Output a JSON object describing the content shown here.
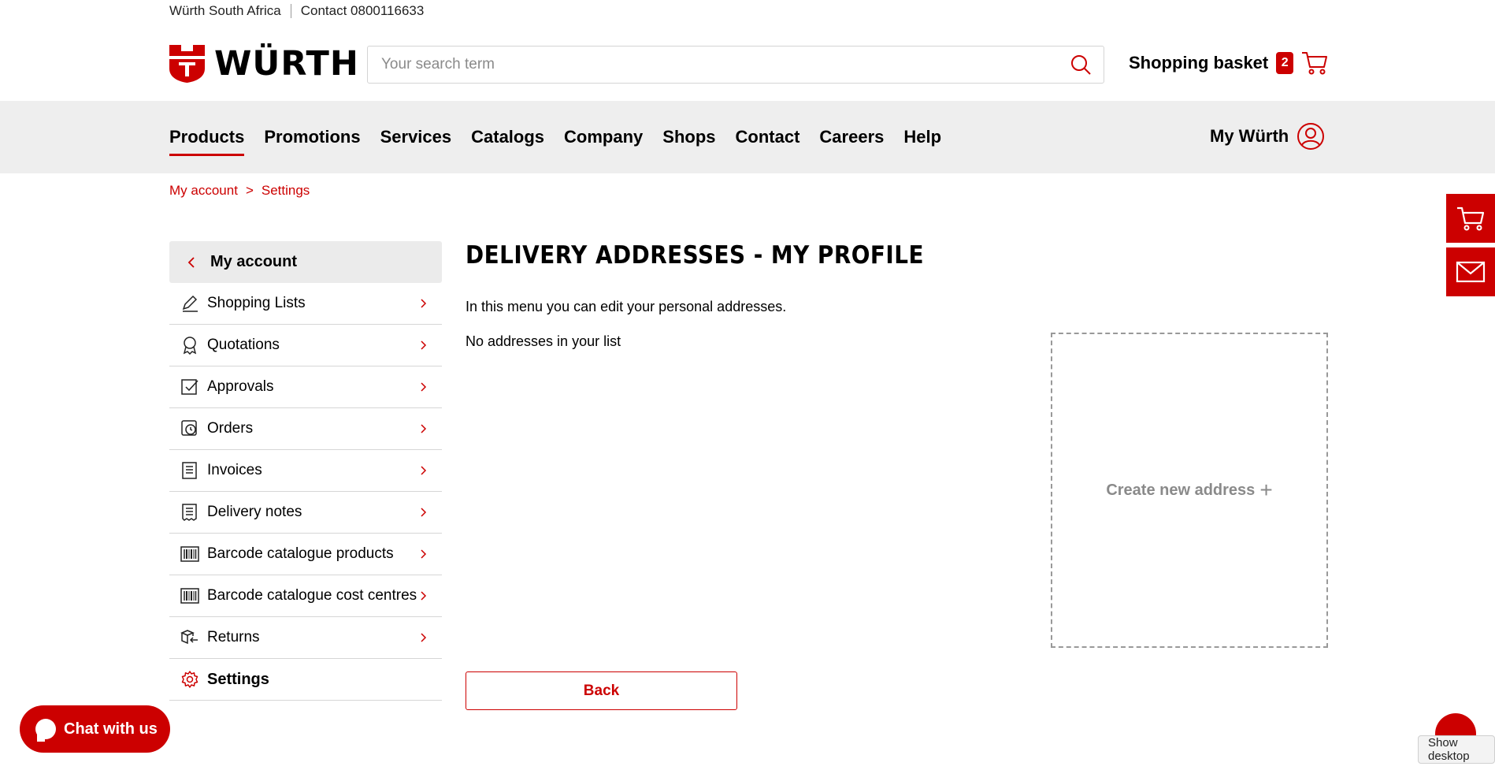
{
  "topbar": {
    "country": "Würth South Africa",
    "contact": "Contact 0800116633"
  },
  "header": {
    "brand": "WÜRTH",
    "search_placeholder": "Your search term",
    "basket_label": "Shopping basket",
    "basket_count": "2"
  },
  "nav": {
    "items": [
      "Products",
      "Promotions",
      "Services",
      "Catalogs",
      "Company",
      "Shops",
      "Contact",
      "Careers",
      "Help"
    ],
    "account_label": "My Würth"
  },
  "breadcrumb": [
    "My account",
    "Settings"
  ],
  "sidebar": {
    "head": "My account",
    "items": [
      {
        "label": "Shopping Lists",
        "icon": "pencil-icon"
      },
      {
        "label": "Quotations",
        "icon": "rosette-icon"
      },
      {
        "label": "Approvals",
        "icon": "checkbox-icon"
      },
      {
        "label": "Orders",
        "icon": "clock-box-icon"
      },
      {
        "label": "Invoices",
        "icon": "invoice-icon"
      },
      {
        "label": "Delivery notes",
        "icon": "receipt-icon"
      },
      {
        "label": "Barcode catalogue products",
        "icon": "barcode-icon"
      },
      {
        "label": "Barcode catalogue cost centres",
        "icon": "barcode-icon"
      },
      {
        "label": "Returns",
        "icon": "returns-icon"
      },
      {
        "label": "Settings",
        "icon": "gear-icon"
      }
    ]
  },
  "main": {
    "title": "DELIVERY ADDRESSES - MY PROFILE",
    "intro": "In this menu you can edit your personal addresses.",
    "empty": "No addresses in your list",
    "create_label": "Create new address",
    "back_label": "Back"
  },
  "chat": {
    "label": "Chat with us"
  },
  "desktop_hint": "Show desktop",
  "colors": {
    "brand_red": "#cc0000",
    "nav_bg": "#eeeeee",
    "sidebar_head_bg": "#ebebeb"
  }
}
